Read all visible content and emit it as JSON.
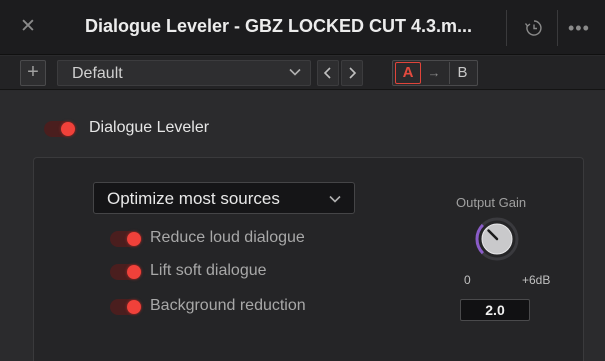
{
  "window": {
    "title": "Dialogue Leveler - GBZ LOCKED CUT 4.3.m..."
  },
  "preset_bar": {
    "preset_name": "Default",
    "compare_a": "A",
    "compare_b": "B"
  },
  "plugin": {
    "name": "Dialogue Leveler",
    "enabled": true,
    "mode": "Optimize most sources",
    "options": [
      {
        "label": "Reduce loud dialogue",
        "enabled": true
      },
      {
        "label": "Lift soft dialogue",
        "enabled": true
      },
      {
        "label": "Background reduction",
        "enabled": true
      }
    ],
    "output_gain": {
      "label": "Output Gain",
      "min_label": "0",
      "max_label": "+6dB",
      "value": "2.0",
      "value_fraction": 0.333
    }
  },
  "colors": {
    "toggle_on": "#f0413a",
    "knob_arc": "#8a5cc8",
    "compare_active": "#e44a3e"
  },
  "icons": {
    "close": "close-icon",
    "history": "history-icon",
    "more": "more-icon",
    "add": "plus-icon",
    "dropdown": "chevron-down-icon",
    "prev": "chevron-left-icon",
    "next": "chevron-right-icon",
    "copy": "arrow-right-icon"
  }
}
